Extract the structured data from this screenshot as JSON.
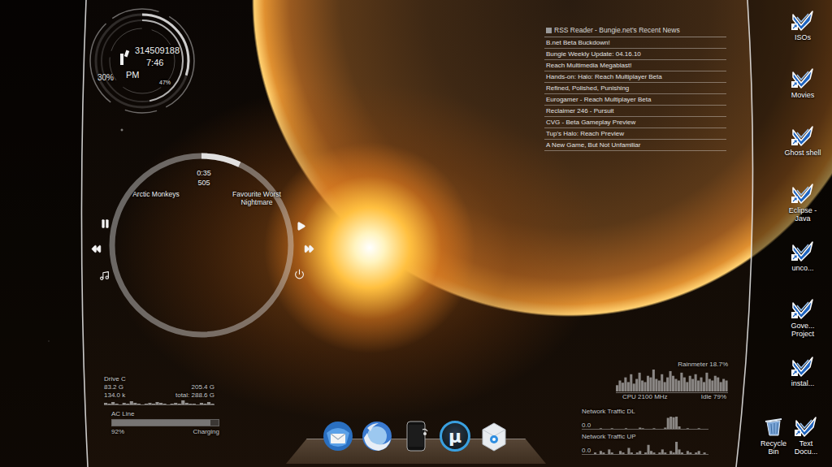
{
  "clock": {
    "counter": "314509188",
    "time": "7:46",
    "period": "PM",
    "rings": [
      {
        "reading": "30%",
        "level": 0.3
      },
      {
        "reading": "47%",
        "level": 0.47
      }
    ]
  },
  "player": {
    "elapsed": "0:35",
    "track_number": "505",
    "artist": "Arctic Monkeys",
    "album": "Favourite Worst Nightmare",
    "level": 0.07,
    "controls": [
      {
        "kind": "pause"
      },
      {
        "kind": "play"
      },
      {
        "kind": "previous"
      },
      {
        "kind": "next"
      },
      {
        "kind": "playlist"
      },
      {
        "kind": "power"
      }
    ]
  },
  "rss": {
    "title": "RSS Reader - Bungie.net's Recent News",
    "items": [
      "B.net Beta Buckdown!",
      "Bungie Weekly Update: 04.16.10",
      "Reach Multimedia Megablast!",
      "Hands-on: Halo: Reach Multiplayer Beta",
      "Refined, Polished, Punishing",
      "Eurogamer - Reach Multiplayer Beta",
      "Reclaimer 246 - Pursuit",
      "CVG - Beta Gameplay Preview",
      "Tup's Halo: Reach Preview",
      "A New Game, But Not Unfamiliar"
    ]
  },
  "drive": {
    "label": "Drive C",
    "used": "83.2 G",
    "free": "205.4 G",
    "io": "134.0 k",
    "total": "total: 288.6 G",
    "values": [
      2,
      1,
      3,
      1,
      0,
      2,
      1,
      4,
      2,
      1,
      0,
      1,
      2,
      1,
      3,
      2,
      1,
      0,
      1,
      2,
      1,
      5,
      2,
      1,
      1,
      0,
      2,
      1,
      3,
      1
    ]
  },
  "battery": {
    "label": "AC Line",
    "level": 0.92,
    "status": "Charging",
    "reading": "92%"
  },
  "cpu": {
    "title": "Rainmeter 18.7%",
    "frequency": "CPU 2100 MHz",
    "idle": "Idle 79%",
    "values": [
      20,
      35,
      28,
      45,
      30,
      55,
      25,
      40,
      60,
      35,
      30,
      50,
      45,
      70,
      40,
      35,
      55,
      30,
      45,
      65,
      50,
      40,
      35,
      60,
      45,
      30,
      50,
      40,
      55,
      35,
      45,
      30,
      60,
      40,
      35,
      50,
      45,
      30,
      40,
      35
    ]
  },
  "network": [
    {
      "label": "Network Traffic DL",
      "reading": "0.0",
      "values": [
        0,
        0,
        1,
        0,
        0,
        0,
        1,
        0,
        0,
        0,
        0,
        1,
        0,
        0,
        0,
        0,
        2,
        1,
        0,
        0,
        0,
        1,
        0,
        0,
        0,
        2,
        18,
        20,
        19,
        20,
        4,
        0,
        0,
        1,
        0,
        0,
        0,
        1,
        0,
        0
      ]
    },
    {
      "label": "Network Traffic UP",
      "reading": "0.0",
      "values": [
        1,
        0,
        2,
        1,
        0,
        3,
        1,
        0,
        0,
        2,
        1,
        0,
        4,
        1,
        0,
        1,
        2,
        0,
        1,
        6,
        2,
        1,
        0,
        1,
        3,
        1,
        0,
        2,
        1,
        8,
        3,
        1,
        0,
        2,
        1,
        0,
        1,
        2,
        0,
        1
      ]
    }
  ],
  "dock": [
    {
      "kind": "mail"
    },
    {
      "kind": "browser"
    },
    {
      "kind": "phone"
    },
    {
      "kind": "torrent",
      "glyph": "µ"
    },
    {
      "kind": "drive"
    }
  ],
  "desktop_icons": [
    {
      "label": "ISOs",
      "kind": "shortcut"
    },
    {
      "label": "Movies",
      "kind": "shortcut"
    },
    {
      "label": "Ghost shell",
      "kind": "shortcut"
    },
    {
      "label": "Eclipse - Java",
      "kind": "shortcut"
    },
    {
      "label": "unco...",
      "kind": "shortcut"
    },
    {
      "label": "Gove... Project",
      "kind": "shortcut"
    },
    {
      "label": "instal...",
      "kind": "shortcut"
    },
    {
      "label": "Recycle Bin",
      "kind": "recycle-bin"
    },
    {
      "label": "Text Docu...",
      "kind": "shortcut"
    }
  ]
}
